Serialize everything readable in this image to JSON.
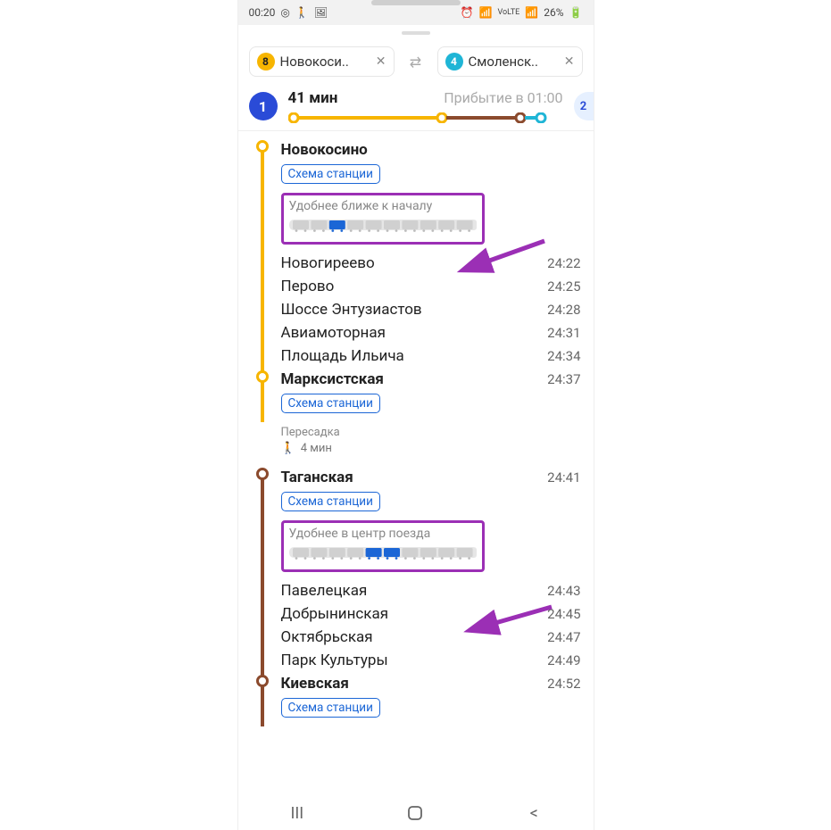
{
  "statusbar": {
    "time": "00:20",
    "battery": "26%"
  },
  "chips": {
    "from_line_num": "8",
    "from_label": "Новокоси..",
    "to_line_num": "4",
    "to_label": "Смоленск.."
  },
  "colors": {
    "line8": "#f7b500",
    "line5": "#8b4a2d",
    "line4": "#1fb5d6",
    "annot": "#9b2fb5"
  },
  "summary": {
    "route_number": "1",
    "duration": "41 мин",
    "arrival": "Прибытие в 01:00",
    "next_route": "2"
  },
  "scheme_label": "Схема станции",
  "transfer": {
    "label": "Пересадка",
    "walk": "4 мин"
  },
  "segment1": {
    "color": "#f7b500",
    "start": {
      "name": "Новокосино"
    },
    "hint": {
      "text": "Удобнее ближе к началу",
      "highlighted": [
        2
      ]
    },
    "stops": [
      {
        "name": "Новогиреево",
        "time": "24:22"
      },
      {
        "name": "Перово",
        "time": "24:25"
      },
      {
        "name": "Шоссе Энтузиастов",
        "time": "24:28"
      },
      {
        "name": "Авиамоторная",
        "time": "24:31"
      },
      {
        "name": "Площадь Ильича",
        "time": "24:34"
      }
    ],
    "end": {
      "name": "Марксистская",
      "time": "24:37"
    }
  },
  "segment2": {
    "color": "#8b4a2d",
    "start": {
      "name": "Таганская",
      "time": "24:41"
    },
    "hint": {
      "text": "Удобнее в центр поезда",
      "highlighted": [
        4,
        5
      ]
    },
    "stops": [
      {
        "name": "Павелецкая",
        "time": "24:43"
      },
      {
        "name": "Добрынинская",
        "time": "24:45"
      },
      {
        "name": "Октябрьская",
        "time": "24:47"
      },
      {
        "name": "Парк Культуры",
        "time": "24:49"
      }
    ],
    "end": {
      "name": "Киевская",
      "time": "24:52"
    }
  }
}
